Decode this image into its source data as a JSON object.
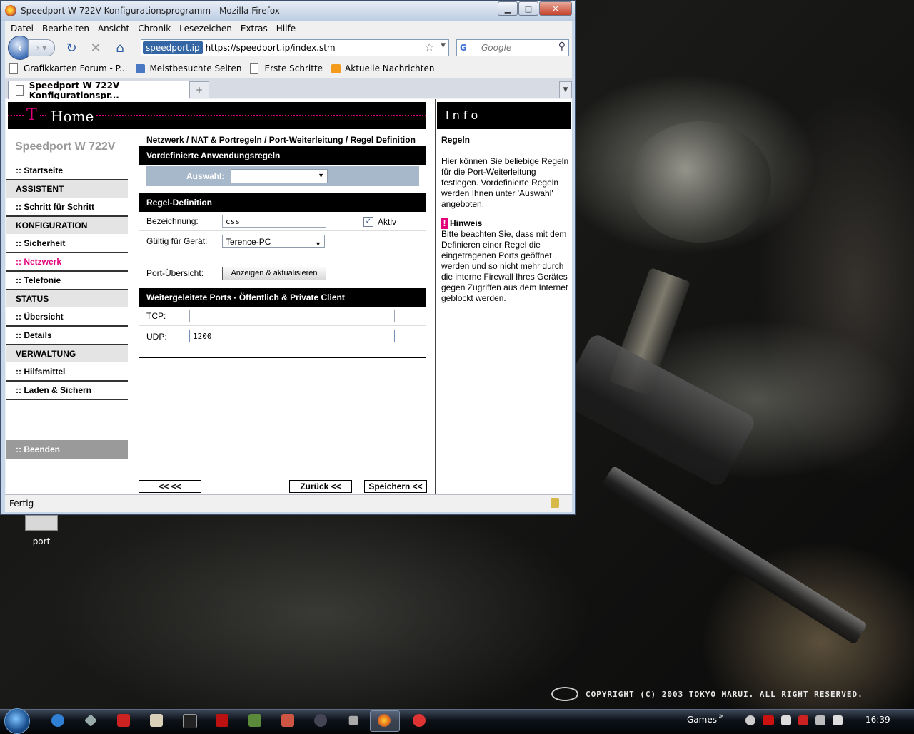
{
  "window": {
    "title": "Speedport W 722V Konfigurationsprogramm - Mozilla Firefox"
  },
  "menu": [
    "Datei",
    "Bearbeiten",
    "Ansicht",
    "Chronik",
    "Lesezeichen",
    "Extras",
    "Hilfe"
  ],
  "urlbar": {
    "site": "speedport.ip",
    "url": "https://speedport.ip/index.stm"
  },
  "search": {
    "placeholder": "Google"
  },
  "bookmarks": [
    "Grafikkarten Forum - P...",
    "Meistbesuchte Seiten",
    "Erste Schritte",
    "Aktuelle Nachrichten"
  ],
  "tab": {
    "title": "Speedport W 722V Konfigurationspr..."
  },
  "newtab": "+",
  "status": "Fertig",
  "page": {
    "header_logo": "T",
    "header_home": "Home",
    "product": "Speedport W 722V",
    "nav": [
      {
        "label": ":: Startseite",
        "type": "link"
      },
      {
        "label": "ASSISTENT",
        "type": "cat"
      },
      {
        "label": ":: Schritt für Schritt",
        "type": "link"
      },
      {
        "label": "KONFIGURATION",
        "type": "cat"
      },
      {
        "label": ":: Sicherheit",
        "type": "link"
      },
      {
        "label": ":: Netzwerk",
        "type": "active"
      },
      {
        "label": ":: Telefonie",
        "type": "link"
      },
      {
        "label": "STATUS",
        "type": "cat"
      },
      {
        "label": ":: Übersicht",
        "type": "link"
      },
      {
        "label": ":: Details",
        "type": "link"
      },
      {
        "label": "VERWALTUNG",
        "type": "cat"
      },
      {
        "label": ":: Hilfsmittel",
        "type": "link"
      },
      {
        "label": ":: Laden & Sichern",
        "type": "link"
      }
    ],
    "nav_end": ":: Beenden",
    "breadcrumb": "Netzwerk / NAT & Portregeln / Port-Weiterleitung / Regel Definition",
    "predefined": {
      "heading": "Vordefinierte Anwendungsregeln",
      "label": "Auswahl:",
      "value": ""
    },
    "rule": {
      "heading": "Regel-Definition",
      "name_label": "Bezeichnung:",
      "name_value": "css",
      "active_label": "Aktiv",
      "active_checked": "✓",
      "device_label": "Gültig für Gerät:",
      "device_value": "Terence-PC",
      "ports_label": "Port-Übersicht:",
      "ports_button": "Anzeigen & aktualisieren"
    },
    "forwarded": {
      "heading": "Weitergeleitete Ports - Öffentlich & Private Client",
      "tcp_label": "TCP:",
      "tcp_value": "",
      "udp_label": "UDP:",
      "udp_value": "1200"
    },
    "buttons": {
      "back_back": "<< <<",
      "back": "Zurück <<",
      "save": "Speichern <<"
    },
    "info": {
      "heading": "Info",
      "title": "Regeln",
      "text": "Hier können Sie beliebige Regeln für die Port-Weiterleitung festlegen. Vordefinierte Regeln werden Ihnen unter 'Auswahl' angeboten.",
      "hint_title": "Hinweis",
      "hint_mark": "!",
      "hint_text": "Bitte beachten Sie, dass mit dem Definieren einer Regel die eingetragenen Ports geöffnet werden und so nicht mehr durch die interne Firewall Ihres Gerätes gegen Zugriffen aus dem Internet geblockt werden."
    }
  },
  "desktop": {
    "icon_label": "port",
    "copyright": "COPYRIGHT (C) 2003 TOKYO MARUI. ALL RIGHT RESERVED."
  },
  "taskbar": {
    "toolbar_label": "Games",
    "clock": "16:39"
  },
  "colors": {
    "magenta": "#e2007a",
    "select_band": "#a7b8cb"
  }
}
